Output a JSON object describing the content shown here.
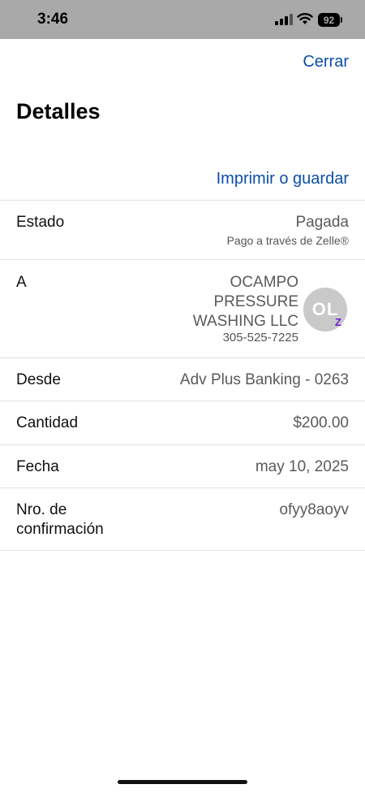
{
  "status_bar": {
    "time": "3:46",
    "battery": "92",
    "icons": [
      "signal-icon",
      "wifi-icon",
      "battery-icon"
    ]
  },
  "header": {
    "close_label": "Cerrar",
    "title": "Detalles",
    "print_label": "Imprimir o guardar"
  },
  "details": {
    "status": {
      "label": "Estado",
      "value": "Pagada",
      "sub": "Pago a través de Zelle®"
    },
    "recipient": {
      "label": "A",
      "name": "OCAMPO PRESSURE WASHING LLC",
      "phone": "305-525-7225",
      "avatar_initials": "OL",
      "badge_icon": "zelle-icon"
    },
    "from": {
      "label": "Desde",
      "value": "Adv Plus Banking - 0263"
    },
    "amount": {
      "label": "Cantidad",
      "value": "$200.00"
    },
    "date": {
      "label": "Fecha",
      "value": "may 10, 2025"
    },
    "confirmation": {
      "label_line1": "Nro. de",
      "label_line2": "confirmación",
      "value": "ofyy8aoyv"
    }
  },
  "colors": {
    "accent": "#0a4fa8",
    "zelle": "#6d1ed4",
    "status_bar": "#a9a9a9"
  }
}
